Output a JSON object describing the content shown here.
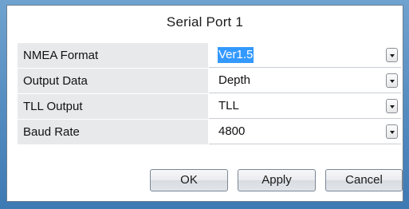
{
  "dialog": {
    "title": "Serial Port 1"
  },
  "settings": [
    {
      "label": "NMEA Format",
      "value": "Ver1.5",
      "selected": true
    },
    {
      "label": "Output Data",
      "value": "Depth",
      "selected": false
    },
    {
      "label": "TLL Output",
      "value": "TLL",
      "selected": false
    },
    {
      "label": "Baud Rate",
      "value": "4800",
      "selected": false
    }
  ],
  "buttons": {
    "ok": "OK",
    "apply": "Apply",
    "cancel": "Cancel"
  },
  "colors": {
    "selection_highlight": "#3399ff",
    "label_background": "#e7e9eb",
    "window_frame": "#4f87bd"
  },
  "icons": {
    "dropdown": "chevron-down-icon"
  }
}
